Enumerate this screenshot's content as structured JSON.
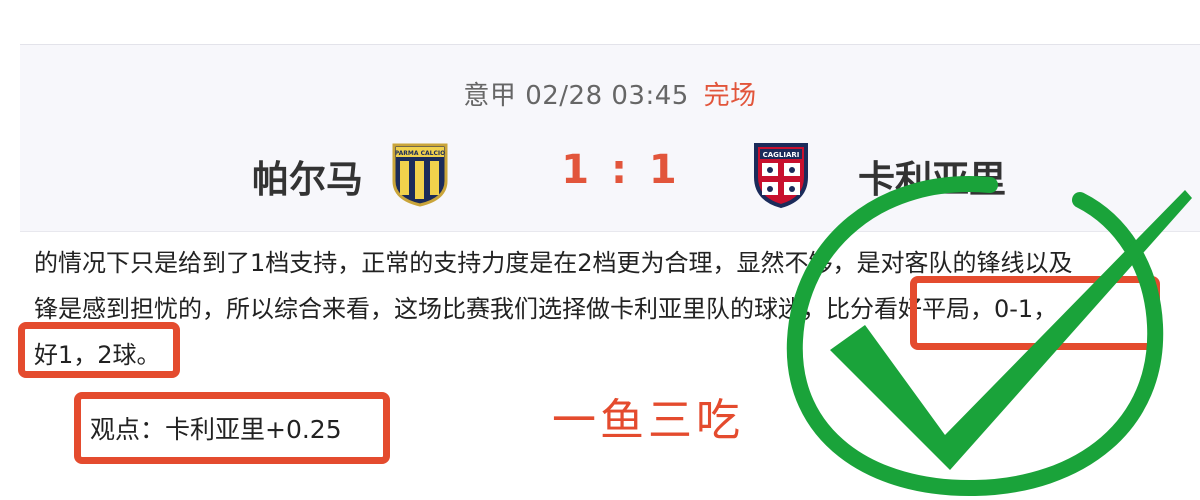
{
  "match": {
    "league": "意甲",
    "datetime": "02/28 03:45",
    "status": "完场",
    "home_team": "帕尔马",
    "away_team": "卡利亚里",
    "score": "1 : 1",
    "home_logo_text": "PARMA CALCIO",
    "away_logo_text": "CAGLIARI"
  },
  "article": {
    "line1": "的情况下只是给到了1档支持，正常的支持力度是在2档更为合理，显然不够，是对客队的锋线以及",
    "line2": "锋是感到担忧的，所以综合来看，这场比赛我们选择做卡利亚里队的球迷，比分看好平局，0-1，",
    "line3": "好1，2球。"
  },
  "opinion": {
    "text": "观点：卡利亚里+0.25"
  },
  "annotation": {
    "text": "一鱼三吃"
  },
  "colors": {
    "accent_red": "#e44b2e",
    "check_green": "#1aa33a",
    "score_red": "#e2553b"
  }
}
